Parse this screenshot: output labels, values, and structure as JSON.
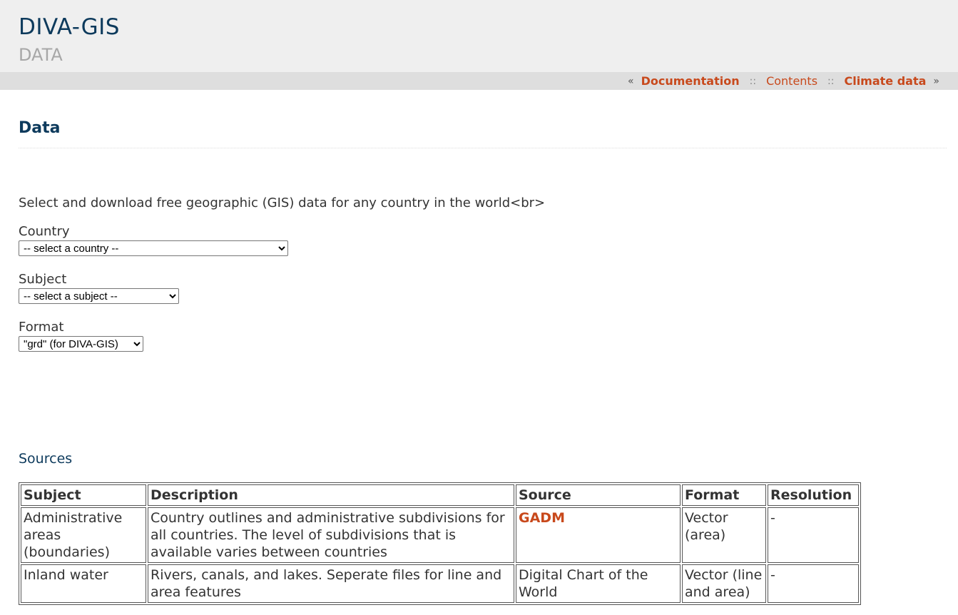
{
  "site": {
    "title": "DIVA-GIS",
    "subtitle": "DATA"
  },
  "nav": {
    "prev_marker": "«",
    "next_marker": "»",
    "separator": "::",
    "documentation": "Documentation",
    "contents": "Contents",
    "climate": "Climate data"
  },
  "page": {
    "title": "Data",
    "intro": "Select and download free geographic (GIS) data for any country in the world<br>"
  },
  "form": {
    "country_label": "Country",
    "country_value": "-- select a country --",
    "subject_label": "Subject",
    "subject_value": "-- select a subject --",
    "format_label": "Format",
    "format_value": "\"grd\" (for DIVA-GIS)"
  },
  "sources": {
    "heading": "Sources",
    "headers": [
      "Subject",
      "Description",
      "Source",
      "Format",
      "Resolution"
    ],
    "rows": [
      [
        "Administrative areas (boundaries)",
        "Country outlines and administrative subdivisions for all countries. The level of subdivisions that is available varies between countries",
        "GADM",
        "Vector (area)",
        "-"
      ],
      [
        "Inland water",
        "Rivers, canals, and lakes. Seperate files for line and area features",
        "Digital Chart of the World",
        "Vector (line and area)",
        "-"
      ]
    ]
  },
  "colors": {
    "brand": "#0d3a5c",
    "link": "#c8491c",
    "header_bg": "#efefef",
    "nav_bg": "#dedede"
  }
}
